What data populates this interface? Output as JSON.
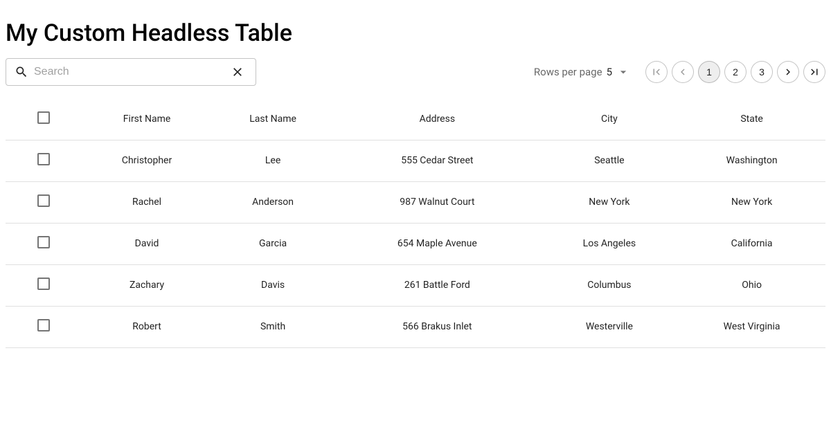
{
  "title": "My Custom Headless Table",
  "search": {
    "placeholder": "Search",
    "value": ""
  },
  "pagination": {
    "rows_label": "Rows per page",
    "rows_per_page": "5",
    "pages": [
      "1",
      "2",
      "3"
    ],
    "current_page": "1"
  },
  "table": {
    "columns": [
      "First Name",
      "Last Name",
      "Address",
      "City",
      "State"
    ],
    "rows": [
      {
        "firstName": "Christopher",
        "lastName": "Lee",
        "address": "555 Cedar Street",
        "city": "Seattle",
        "state": "Washington"
      },
      {
        "firstName": "Rachel",
        "lastName": "Anderson",
        "address": "987 Walnut Court",
        "city": "New York",
        "state": "New York"
      },
      {
        "firstName": "David",
        "lastName": "Garcia",
        "address": "654 Maple Avenue",
        "city": "Los Angeles",
        "state": "California"
      },
      {
        "firstName": "Zachary",
        "lastName": "Davis",
        "address": "261 Battle Ford",
        "city": "Columbus",
        "state": "Ohio"
      },
      {
        "firstName": "Robert",
        "lastName": "Smith",
        "address": "566 Brakus Inlet",
        "city": "Westerville",
        "state": "West Virginia"
      }
    ]
  }
}
